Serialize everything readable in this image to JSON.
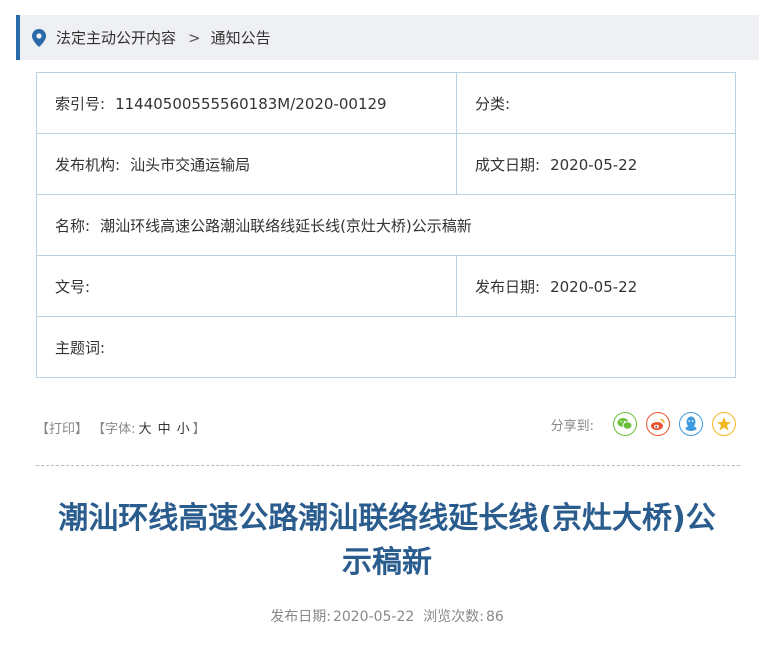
{
  "breadcrumb": {
    "items": [
      "法定主动公开内容",
      "通知公告"
    ],
    "separator": ">"
  },
  "meta": {
    "index_label": "索引号:",
    "index_value": "11440500555560183M/2020-00129",
    "category_label": "分类:",
    "category_value": "",
    "publisher_label": "发布机构:",
    "publisher_value": "汕头市交通运输局",
    "created_label": "成文日期:",
    "created_value": "2020-05-22",
    "name_label": "名称:",
    "name_value": "潮汕环线高速公路潮汕联络线延长线(京灶大桥)公示稿新",
    "docno_label": "文号:",
    "docno_value": "",
    "published_label": "发布日期:",
    "published_value": "2020-05-22",
    "keywords_label": "主题词:",
    "keywords_value": ""
  },
  "toolbar": {
    "print": "【打印】",
    "font_prefix": "【字体:",
    "font_large": "大",
    "font_medium": "中",
    "font_small": "小",
    "font_suffix": "】",
    "share_label": "分享到:",
    "share_icons": [
      "wechat-icon",
      "weibo-icon",
      "qq-icon",
      "qzone-icon"
    ]
  },
  "article": {
    "title_line1": "潮汕环线高速公路潮汕联络线延长线(京灶大桥)公",
    "title_line2": "示稿新",
    "pub_date_label": "发布日期:",
    "pub_date": "2020-05-22",
    "views_label": "浏览次数:",
    "views": "86"
  },
  "colors": {
    "accent": "#2a6aa8",
    "title": "#2a5d8e",
    "table_border": "#b9d3e2",
    "breadcrumb_bg": "#eef0f3",
    "wechat": "#6bbf3a",
    "weibo": "#e8542f",
    "qq": "#3f9be0",
    "qzone": "#f2b71f"
  }
}
